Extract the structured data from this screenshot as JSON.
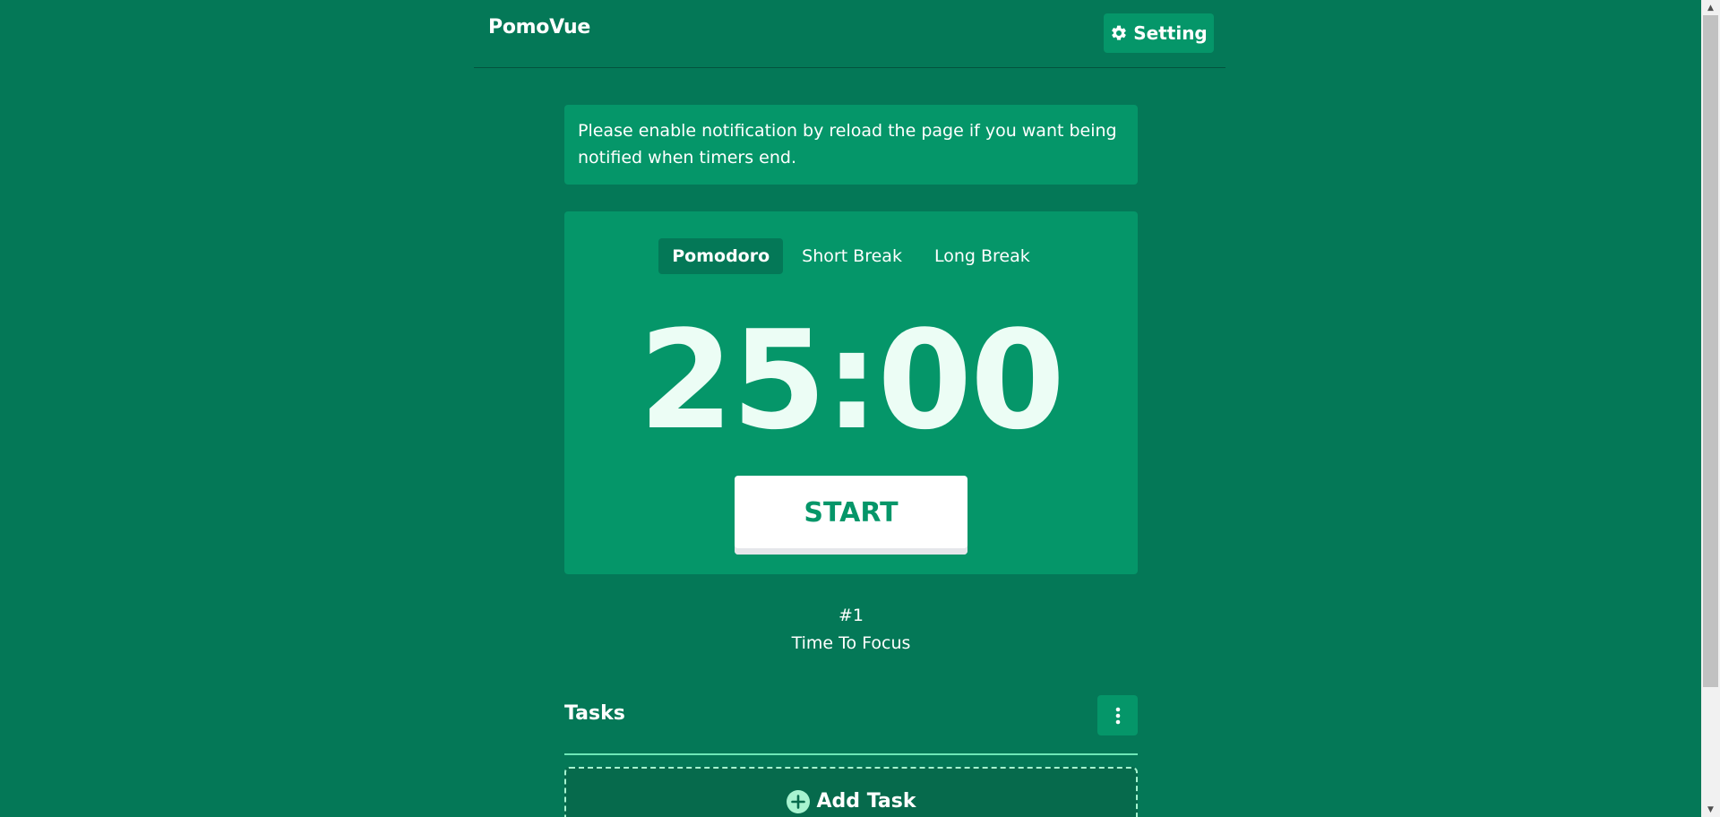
{
  "header": {
    "logo": "PomoVue",
    "setting_label": "Setting"
  },
  "notice": {
    "text": "Please enable notification by reload the page if you want being notified when timers end."
  },
  "timer": {
    "tabs": [
      {
        "label": "Pomodoro",
        "active": true
      },
      {
        "label": "Short Break",
        "active": false
      },
      {
        "label": "Long Break",
        "active": false
      }
    ],
    "time": "25:00",
    "start_label": "START"
  },
  "session": {
    "count": "#1",
    "message": "Time To Focus"
  },
  "tasks": {
    "title": "Tasks",
    "add_label": "Add Task"
  },
  "colors": {
    "background": "#047857",
    "card": "#059669",
    "accent": "#6ee7b7"
  },
  "icons": {
    "setting": "gear-icon",
    "menu": "kebab-menu-icon",
    "add": "plus-circle-icon"
  }
}
